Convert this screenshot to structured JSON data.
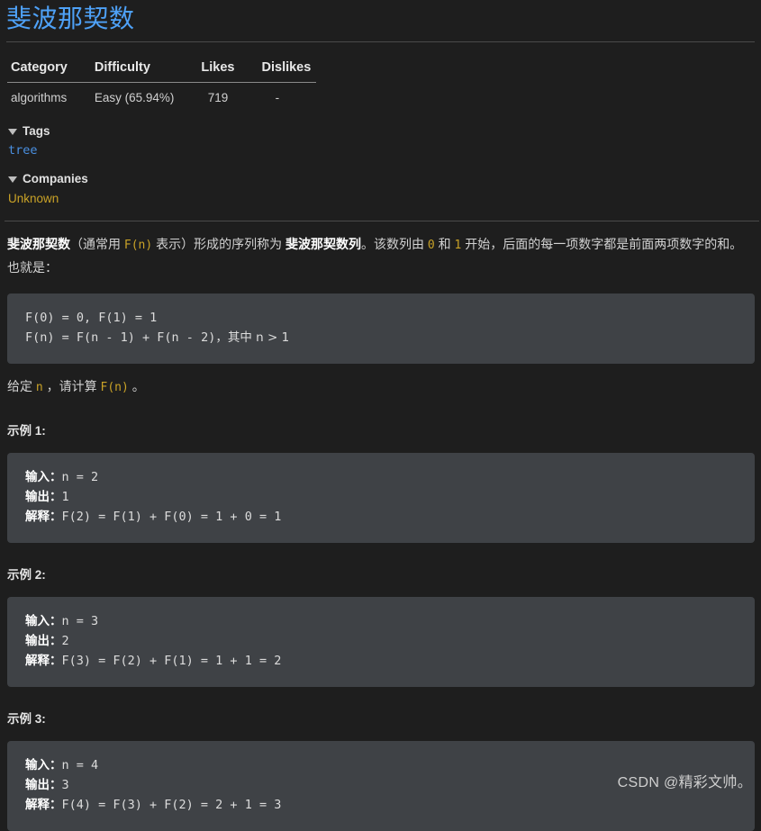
{
  "title": "斐波那契数",
  "meta_table": {
    "headers": [
      "Category",
      "Difficulty",
      "Likes",
      "Dislikes"
    ],
    "rows": [
      {
        "category": "algorithms",
        "difficulty": "Easy (65.94%)",
        "likes": "719",
        "dislikes": "-"
      }
    ]
  },
  "tags_section": {
    "label": "Tags",
    "items": [
      "tree"
    ]
  },
  "companies_section": {
    "label": "Companies",
    "items": [
      "Unknown"
    ]
  },
  "description": {
    "bold_lead": "斐波那契数",
    "part1": "（通常用 ",
    "code_fn": "F(n)",
    "part2": " 表示）形成的序列称为 ",
    "bold_seq": "斐波那契数列",
    "part3": "。该数列由 ",
    "code_zero": "0",
    "part4": " 和 ",
    "code_one": "1",
    "part5": " 开始，后面的每一项数字都是前面两项数字的和。也就是：",
    "formula_line1": "F(0) = 0, F(1) = 1",
    "formula_line2_a": "F(n) = F(n - 1) + F(n - 2)",
    "formula_line2_b": "，其中 n > 1",
    "closing_a": "给定 ",
    "closing_code_n": "n",
    "closing_b": " ，请计算 ",
    "closing_code_fn": "F(n)",
    "closing_c": " 。"
  },
  "examples": [
    {
      "heading": "示例 1:",
      "input_label": "输入：",
      "input_value": "n = 2",
      "output_label": "输出：",
      "output_value": "1",
      "explain_label": "解释：",
      "explain_value": "F(2) = F(1) + F(0) = 1 + 0 = 1"
    },
    {
      "heading": "示例 2:",
      "input_label": "输入：",
      "input_value": "n = 3",
      "output_label": "输出：",
      "output_value": "2",
      "explain_label": "解释：",
      "explain_value": "F(3) = F(2) + F(1) = 1 + 1 = 2"
    },
    {
      "heading": "示例 3:",
      "input_label": "输入：",
      "input_value": "n = 4",
      "output_label": "输出：",
      "output_value": "3",
      "explain_label": "解释：",
      "explain_value": "F(4) = F(3) + F(2) = 2 + 1 = 3"
    }
  ],
  "watermark": "CSDN @精彩文帅。",
  "colors": {
    "background": "#1e1e1e",
    "code_background": "#3f4246",
    "title_blue": "#4ea1f7",
    "tag_blue": "#4a90e2",
    "company_gold": "#c9a227",
    "inline_code_gold": "#c9a227",
    "divider": "#4a4a4a"
  }
}
